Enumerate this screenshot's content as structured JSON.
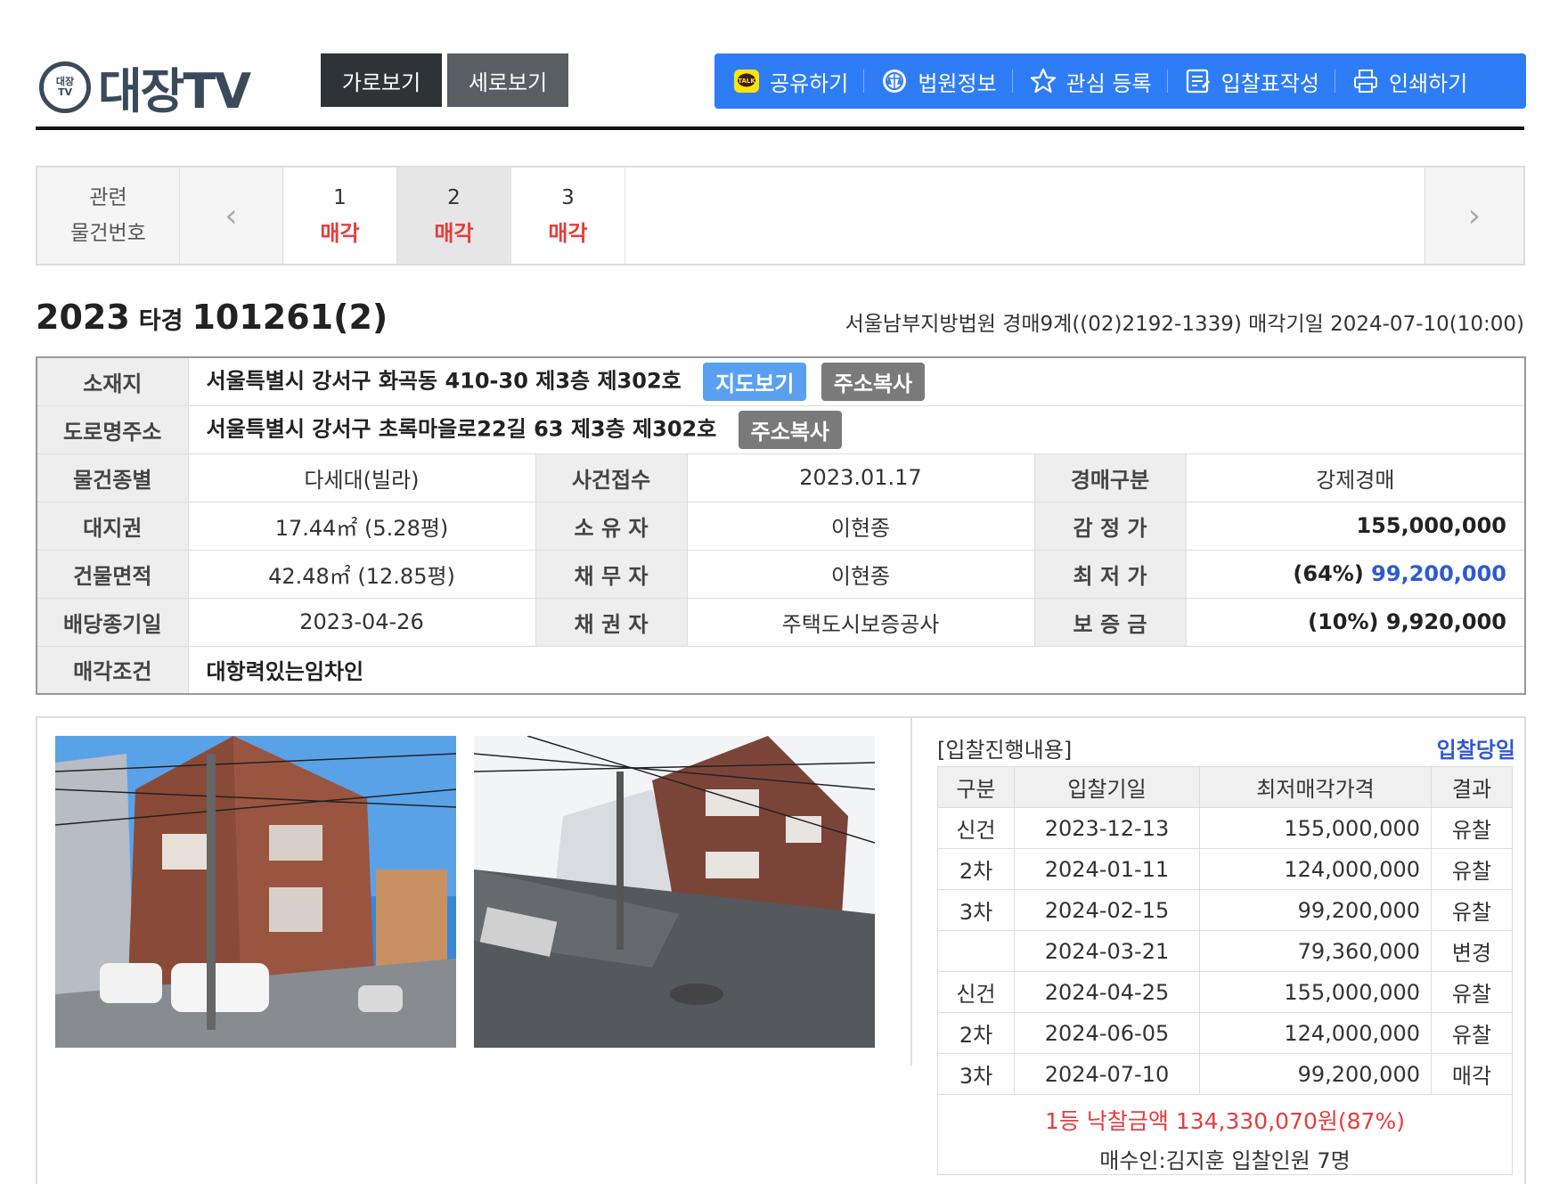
{
  "header": {
    "logo_mark": "대장TV",
    "logo_text": "대장TV",
    "view_horizontal": "가로보기",
    "view_vertical": "세로보기",
    "tools": [
      {
        "label": "공유하기",
        "icon": "kakao-talk-icon"
      },
      {
        "label": "법원정보",
        "icon": "court-icon"
      },
      {
        "label": "관심 등록",
        "icon": "star-icon"
      },
      {
        "label": "입찰표작성",
        "icon": "form-icon"
      },
      {
        "label": "인쇄하기",
        "icon": "printer-icon"
      }
    ],
    "colors": {
      "toolbar": "#2f7df6",
      "accent_red": "#e63c3c",
      "accent_blue": "#2f5ad0"
    }
  },
  "related": {
    "label_line1": "관련",
    "label_line2": "물건번호",
    "items": [
      {
        "num": "1",
        "status": "매각"
      },
      {
        "num": "2",
        "status": "매각"
      },
      {
        "num": "3",
        "status": "매각"
      }
    ]
  },
  "case": {
    "year": "2023",
    "type": "타경",
    "number": "101261(2)",
    "info": "서울남부지방법원 경매9계((02)2192-1339) 매각기일 2024-07-10(10:00)"
  },
  "info": {
    "location_label": "소재지",
    "location": "서울특별시 강서구 화곡동 410-30 제3층 제302호",
    "map_button": "지도보기",
    "copy_button": "주소복사",
    "road_label": "도로명주소",
    "road": "서울특별시 강서구 초록마을로22길 63 제3층 제302호",
    "rows": [
      {
        "l1": "물건종별",
        "v1": "다세대(빌라)",
        "l2": "사건접수",
        "v2": "2023.01.17",
        "l3": "경매구분",
        "v3": "강제경매"
      },
      {
        "l1": "대지권",
        "v1": "17.44㎡ (5.28평)",
        "l2": "소 유 자",
        "v2": "이현종",
        "l3": "감 정 가",
        "v3": "155,000,000"
      },
      {
        "l1": "건물면적",
        "v1": "42.48㎡ (12.85평)",
        "l2": "채 무 자",
        "v2": "이현종",
        "l3": "최 저 가",
        "v3_pct": "(64%)",
        "v3": "99,200,000"
      },
      {
        "l1": "배당종기일",
        "v1": "2023-04-26",
        "l2": "채 권 자",
        "v2": "주택도시보증공사",
        "l3": "보 증 금",
        "v3": "(10%) 9,920,000"
      }
    ],
    "condition_label": "매각조건",
    "condition": "대항력있는임차인"
  },
  "bids": {
    "title": "[입찰진행내용]",
    "today_link": "입찰당일",
    "headers": [
      "구분",
      "입찰기일",
      "최저매각가격",
      "결과"
    ],
    "rows": [
      {
        "round": "신건",
        "date": "2023-12-13",
        "price": "155,000,000",
        "result": "유찰"
      },
      {
        "round": "2차",
        "date": "2024-01-11",
        "price": "124,000,000",
        "result": "유찰"
      },
      {
        "round": "3차",
        "date": "2024-02-15",
        "price": "99,200,000",
        "result": "유찰"
      },
      {
        "round": "",
        "date": "2024-03-21",
        "price": "79,360,000",
        "result": "변경"
      },
      {
        "round": "신건",
        "date": "2024-04-25",
        "price": "155,000,000",
        "result": "유찰"
      },
      {
        "round": "2차",
        "date": "2024-06-05",
        "price": "124,000,000",
        "result": "유찰"
      },
      {
        "round": "3차",
        "date": "2024-07-10",
        "price": "99,200,000",
        "result": "매각"
      }
    ],
    "winning": "1등 낙찰금액 134,330,070원(87%)",
    "buyer": "매수인:김지훈 입찰인원 7명"
  }
}
